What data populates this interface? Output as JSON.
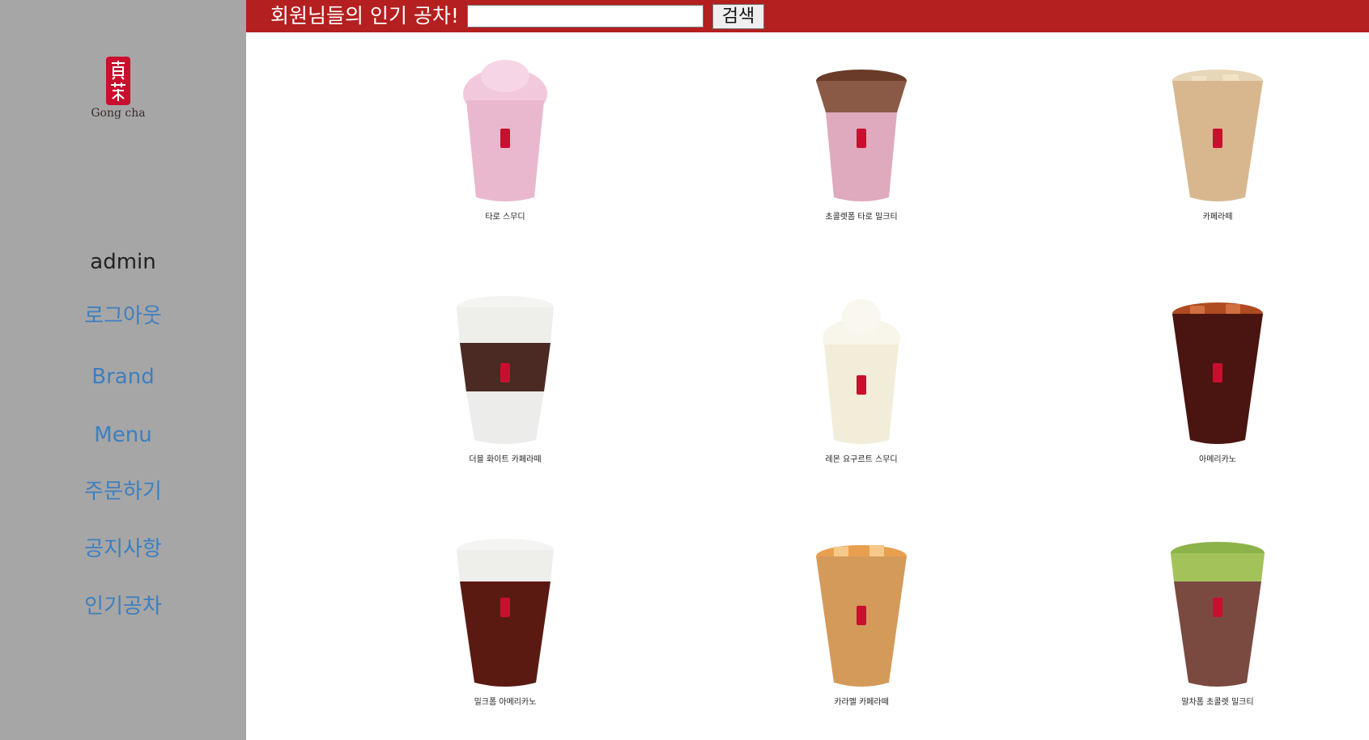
{
  "sidebar": {
    "logo": {
      "icon": "gongcha-logo",
      "text": "Gong cha",
      "color": "#c8102e"
    },
    "user": "admin",
    "links": [
      {
        "label": "로그아웃",
        "name": "nav-logout"
      },
      {
        "label": "Brand",
        "name": "nav-brand"
      },
      {
        "label": "Menu",
        "name": "nav-menu"
      },
      {
        "label": "주문하기",
        "name": "nav-order"
      },
      {
        "label": "공지사항",
        "name": "nav-notice"
      },
      {
        "label": "인기공차",
        "name": "nav-popular"
      }
    ]
  },
  "topbar": {
    "title": "회원님들의 인기 공차!",
    "search_value": "",
    "search_button": "검색",
    "bg_color": "#b41f1f"
  },
  "products": [
    {
      "name": "타로 스무디",
      "icon": "drink-taro-smoothie"
    },
    {
      "name": "초콜렛폼 타로 밀크티",
      "icon": "drink-choco-foam-taro-milk-tea"
    },
    {
      "name": "카페라떼",
      "icon": "drink-cafe-latte"
    },
    {
      "name": "더블 화이트 카페라떼",
      "icon": "drink-double-white-cafe-latte"
    },
    {
      "name": "레몬 요구르트 스무디",
      "icon": "drink-lemon-yogurt-smoothie"
    },
    {
      "name": "아메리카노",
      "icon": "drink-americano"
    },
    {
      "name": "밀크폼 아메리카노",
      "icon": "drink-milk-foam-americano"
    },
    {
      "name": "카라멜 카페라떼",
      "icon": "drink-caramel-cafe-latte"
    },
    {
      "name": "말차폼 초콜렛 밀크티",
      "icon": "drink-matcha-foam-choco-milk-tea"
    }
  ]
}
